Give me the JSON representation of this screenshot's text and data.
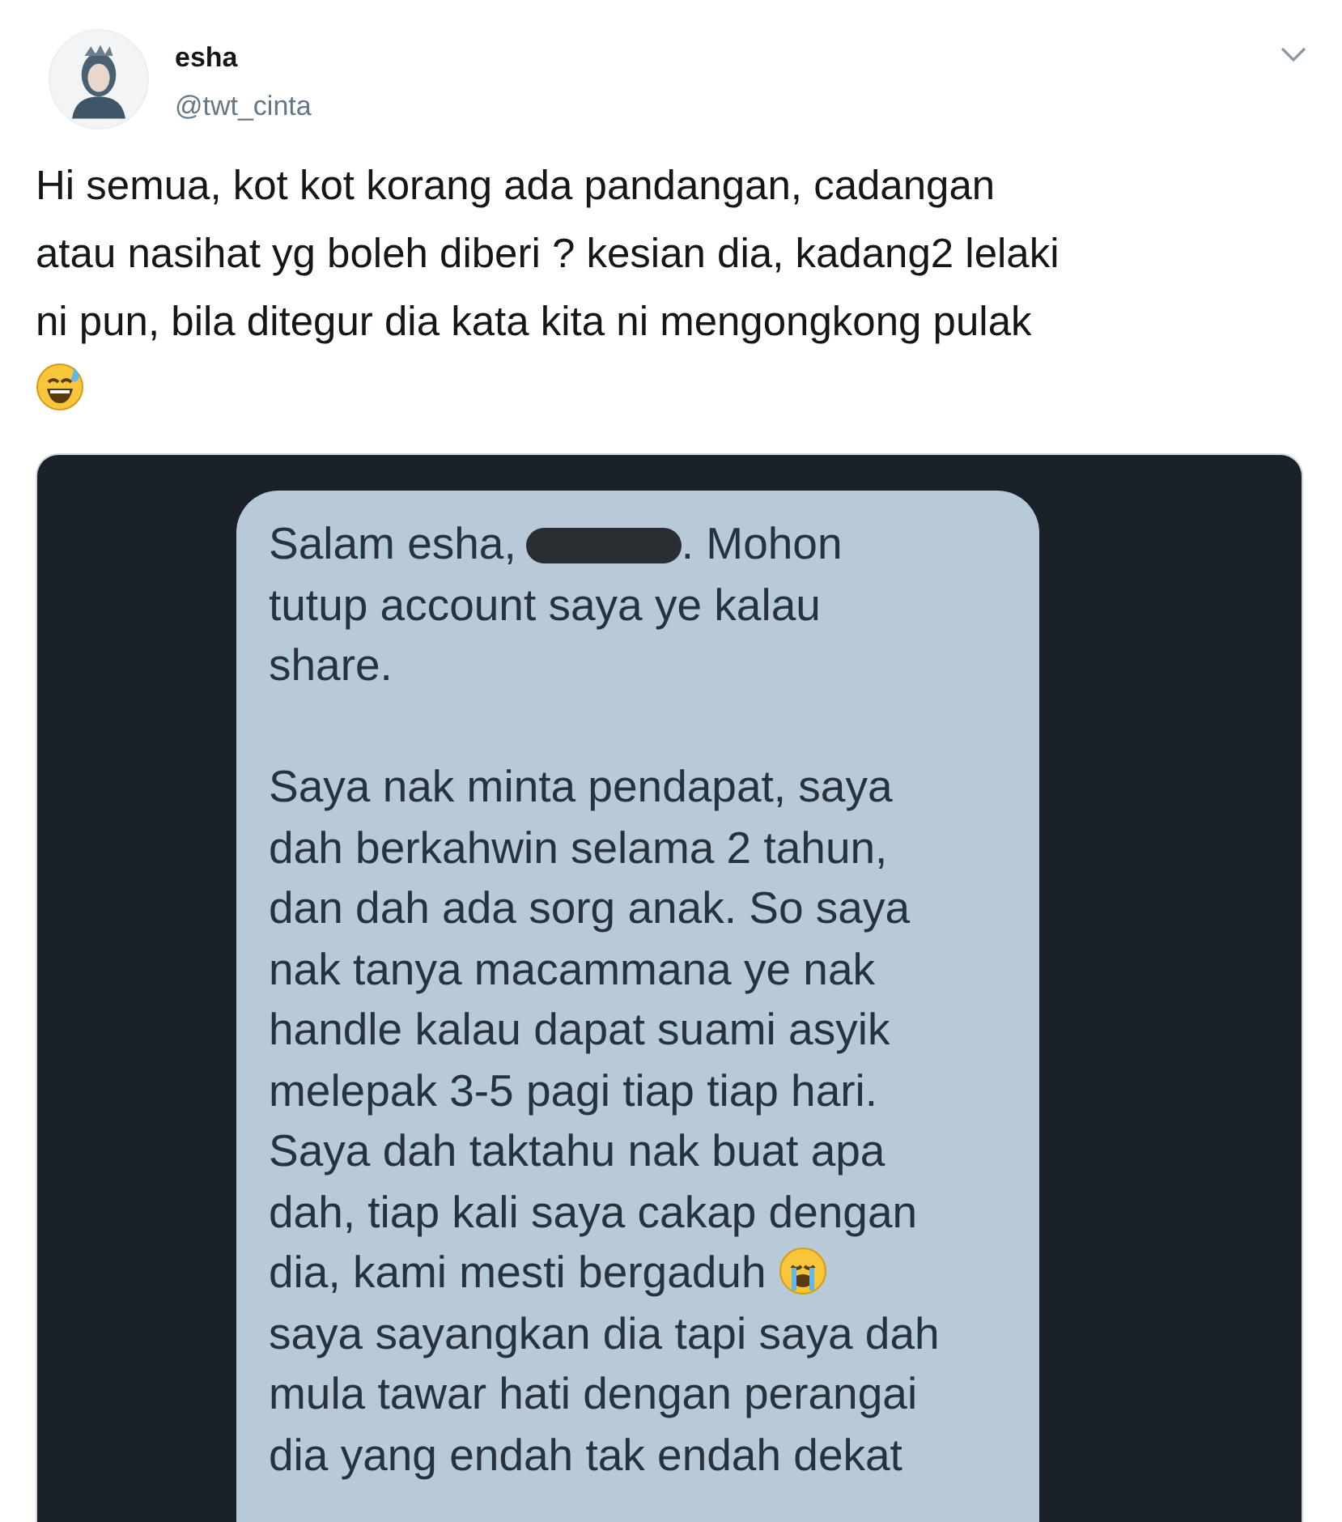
{
  "author": {
    "name": "esha",
    "handle": "@twt_cinta"
  },
  "tweet": {
    "text_lines": [
      "Hi semua, kot kot korang ada pandangan, cadangan",
      "atau nasihat yg boleh diberi ? kesian dia, kadang2 lelaki",
      "ni pun, bila ditegur dia kata kita ni mengongkong pulak"
    ]
  },
  "message": {
    "greeting": "Salam esha,",
    "after_redaction": ". Mohon",
    "continuation_lines": [
      "tutup account saya ye kalau",
      "share."
    ],
    "body_lines": [
      "Saya nak minta pendapat, saya",
      "dah berkahwin selama 2 tahun,",
      "dan dah ada sorg anak. So saya",
      "nak tanya macammana ye nak",
      "handle kalau dapat suami asyik",
      "melepak 3-5 pagi tiap tiap hari.",
      "Saya dah taktahu nak buat apa",
      "dah, tiap kali saya cakap dengan",
      "dia, kami mesti bergaduh",
      "saya sayangkan dia tapi saya dah",
      "mula tawar hati dengan perangai",
      "dia yang endah tak endah dekat"
    ]
  }
}
